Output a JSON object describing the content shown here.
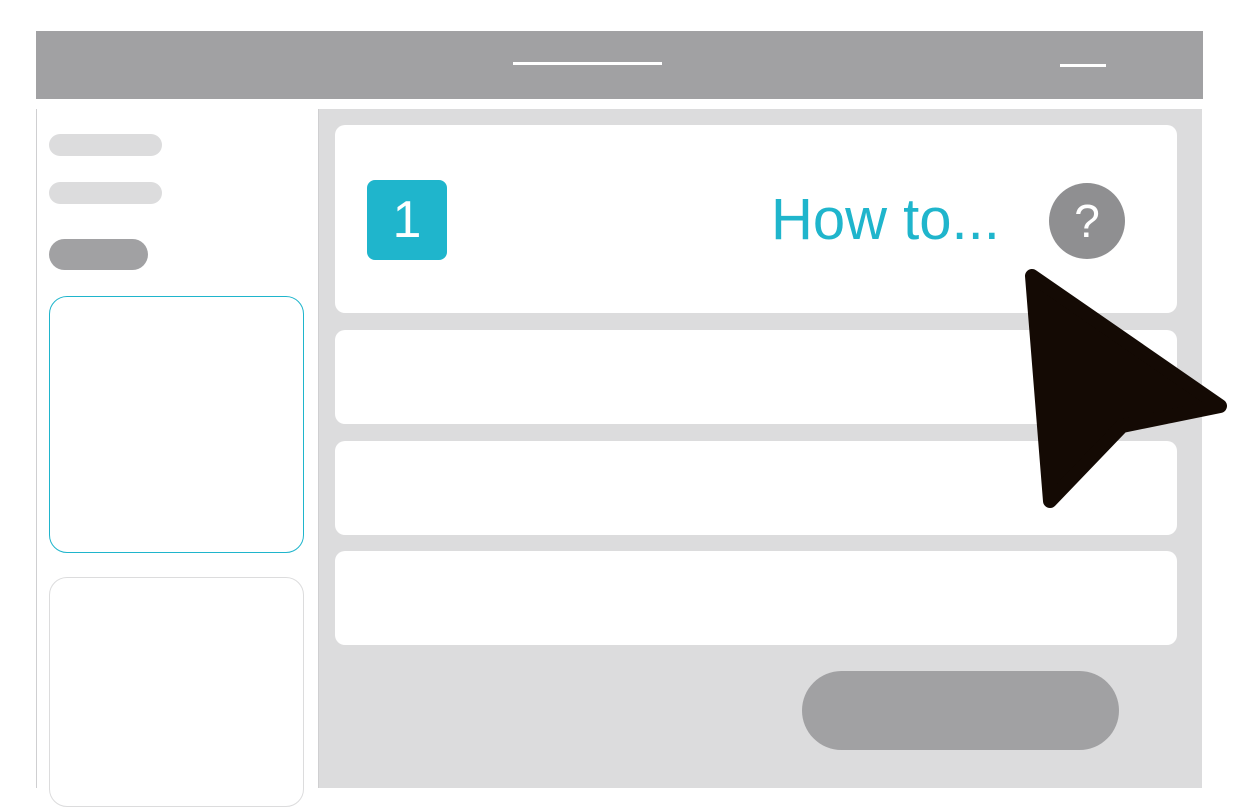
{
  "step": {
    "number": "1",
    "heading": "How to...",
    "help_icon_glyph": "?"
  },
  "colors": {
    "accent": "#1fb5cc",
    "header": "#a1a1a3",
    "canvas": "#dcdcdd"
  },
  "icons": {
    "help": "question-circle-icon",
    "pointer": "mouse-cursor-icon"
  }
}
